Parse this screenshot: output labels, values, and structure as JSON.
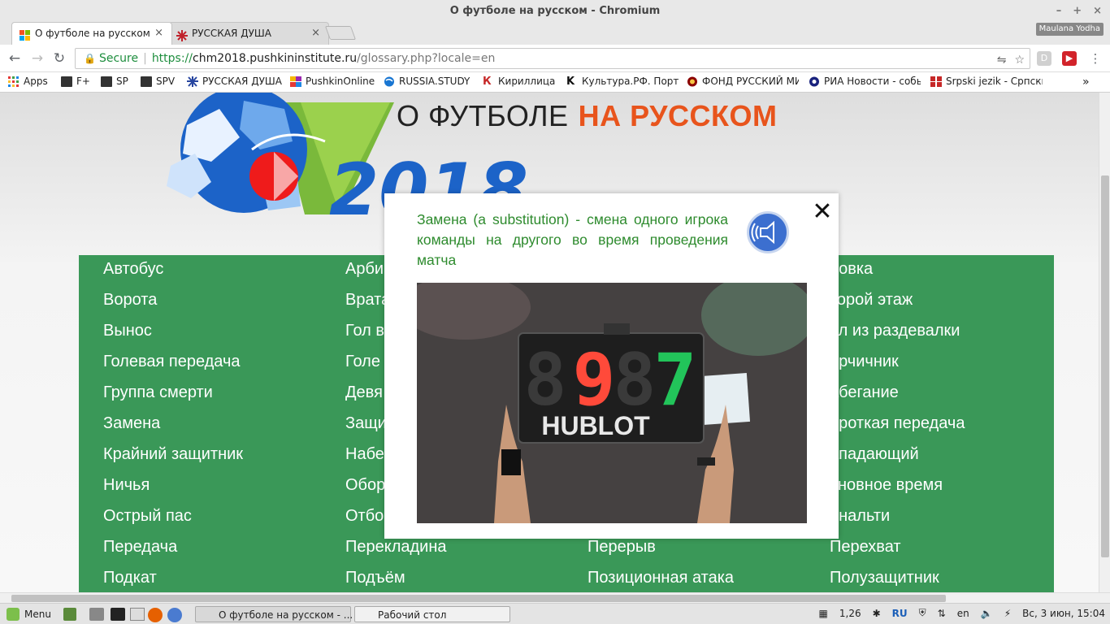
{
  "window": {
    "title": "О футболе на русском - Chromium",
    "controls": [
      "–",
      "+",
      "×"
    ]
  },
  "tabs": [
    {
      "label": "О футболе на русском",
      "close": "×"
    },
    {
      "label": "РУССКАЯ ДУША",
      "close": "×"
    }
  ],
  "profile_badge": "Maulana Yodha",
  "address_bar": {
    "secure_label": "Secure",
    "url_scheme": "https://",
    "url_host": "chm2018.pushkininstitute.ru",
    "url_path": "/glossary.php?locale=en"
  },
  "bookmarks": [
    {
      "label": "Apps",
      "icon": "apps-grid-icon"
    },
    {
      "label": "F+",
      "icon": "folder-icon"
    },
    {
      "label": "SP",
      "icon": "folder-icon"
    },
    {
      "label": "SPV",
      "icon": "folder-icon"
    },
    {
      "label": "РУССКАЯ ДУША",
      "icon": "snowflake-icon"
    },
    {
      "label": "PushkinOnline",
      "icon": "pushkin-icon"
    },
    {
      "label": "RUSSIA.STUDY",
      "icon": "globe-icon"
    },
    {
      "label": "Кириллица",
      "icon": "k-icon"
    },
    {
      "label": "Культура.РФ. Порта",
      "icon": "k-icon"
    },
    {
      "label": "ФОНД РУССКИЙ МИ",
      "icon": "fund-icon"
    },
    {
      "label": "РИА Новости - собь",
      "icon": "ria-icon"
    },
    {
      "label": "Srpski jezik - Српски",
      "icon": "grid-icon"
    }
  ],
  "site": {
    "title_main": "О ФУТБОЛЕ",
    "title_accent": "НА РУССКОМ",
    "logo_year": "2018"
  },
  "glossary_columns": [
    [
      "Автобус",
      "Ворота",
      "Вынос",
      "Голевая передача",
      "Группа смерти",
      "Замена",
      "Крайний защитник",
      "Ничья",
      "Острый пас",
      "Передача",
      "Подкат"
    ],
    [
      "Арби",
      "Врата",
      "Гол в",
      "Голе",
      "Девя",
      "Защи",
      "Набе",
      "Обор",
      "Отбо",
      "Перекладина",
      "Подъём"
    ],
    [
      "",
      "",
      "",
      "",
      "",
      "",
      "",
      "",
      "",
      "Перерыв",
      "Позиционная атака"
    ],
    [
      "ровка",
      "торой этаж",
      "ол из раздевалки",
      "орчичник",
      "абегание",
      "ороткая передача",
      "ападающий",
      "сновное время",
      "енальти",
      "Перехват",
      "Полузащитник"
    ]
  ],
  "modal": {
    "definition": "Замена (a substitution) - смена одного игрока команды на другого во время проведения матча",
    "close_symbol": "✕",
    "board_left": "9",
    "board_right": "7",
    "board_brand": "HUBLOT"
  },
  "taskbar": {
    "menu_label": "Menu",
    "windows": [
      {
        "label": "О футболе на русском - ..."
      },
      {
        "label": "Рабочий стол"
      }
    ],
    "battery_value": "1,26",
    "keyboard_layout": "RU",
    "lang": "en",
    "clock": "Вс, 3 июн, 15:04"
  },
  "colors": {
    "glossary_green": "#3a9858",
    "title_accent": "#e8541c",
    "definition_green": "#2e8b2e",
    "secure_green": "#1e8e3e"
  }
}
